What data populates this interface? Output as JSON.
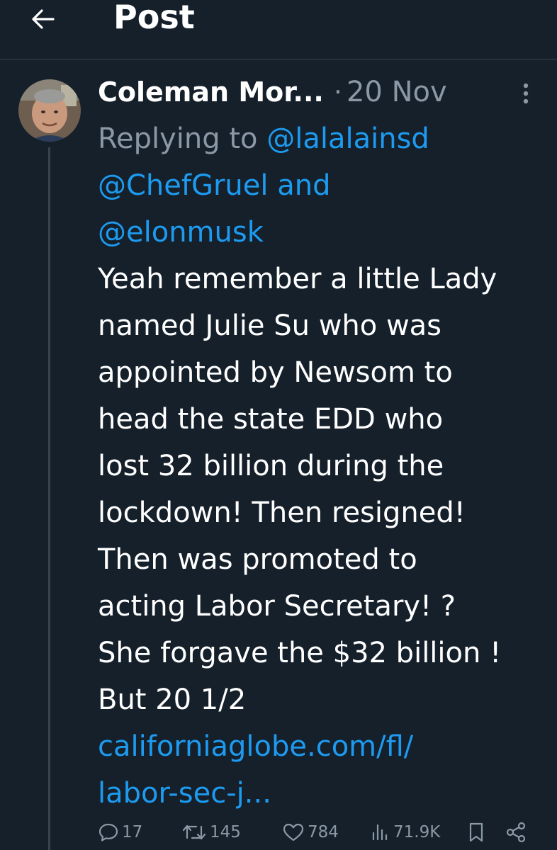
{
  "header": {
    "title": "Post",
    "back_icon": "arrow-left-icon"
  },
  "post": {
    "author_name": "Coleman Mor...",
    "separator": "·",
    "date": "20 Nov",
    "avatar_icon": "user-avatar",
    "reply_prefix": "Replying to",
    "mention_1": "@lalalainsd",
    "mention_2": "@ChefGruel",
    "mention_joiner": "and",
    "mention_3": "@elonmusk",
    "body_lines": [
      "Yeah remember a little Lady",
      "named Julie Su who was",
      "appointed by Newsom to",
      "head the state EDD who",
      "lost 32 billion during the",
      "lockdown! Then resigned!",
      "Then was promoted to",
      "acting Labor Secretary! ?",
      "She forgave the $32 billion !",
      "But 20 1/2"
    ],
    "link_lines": [
      "californiaglobe.com/fl/",
      "labor-sec-j..."
    ]
  },
  "actions": {
    "reply_count": "17",
    "repost_count": "145",
    "like_count": "784",
    "views_count": "71.9K"
  },
  "colors": {
    "background": "#15202b",
    "text": "#ffffff",
    "secondary": "#8b98a5",
    "accent": "#1d9bf0",
    "divider": "#38444d"
  }
}
